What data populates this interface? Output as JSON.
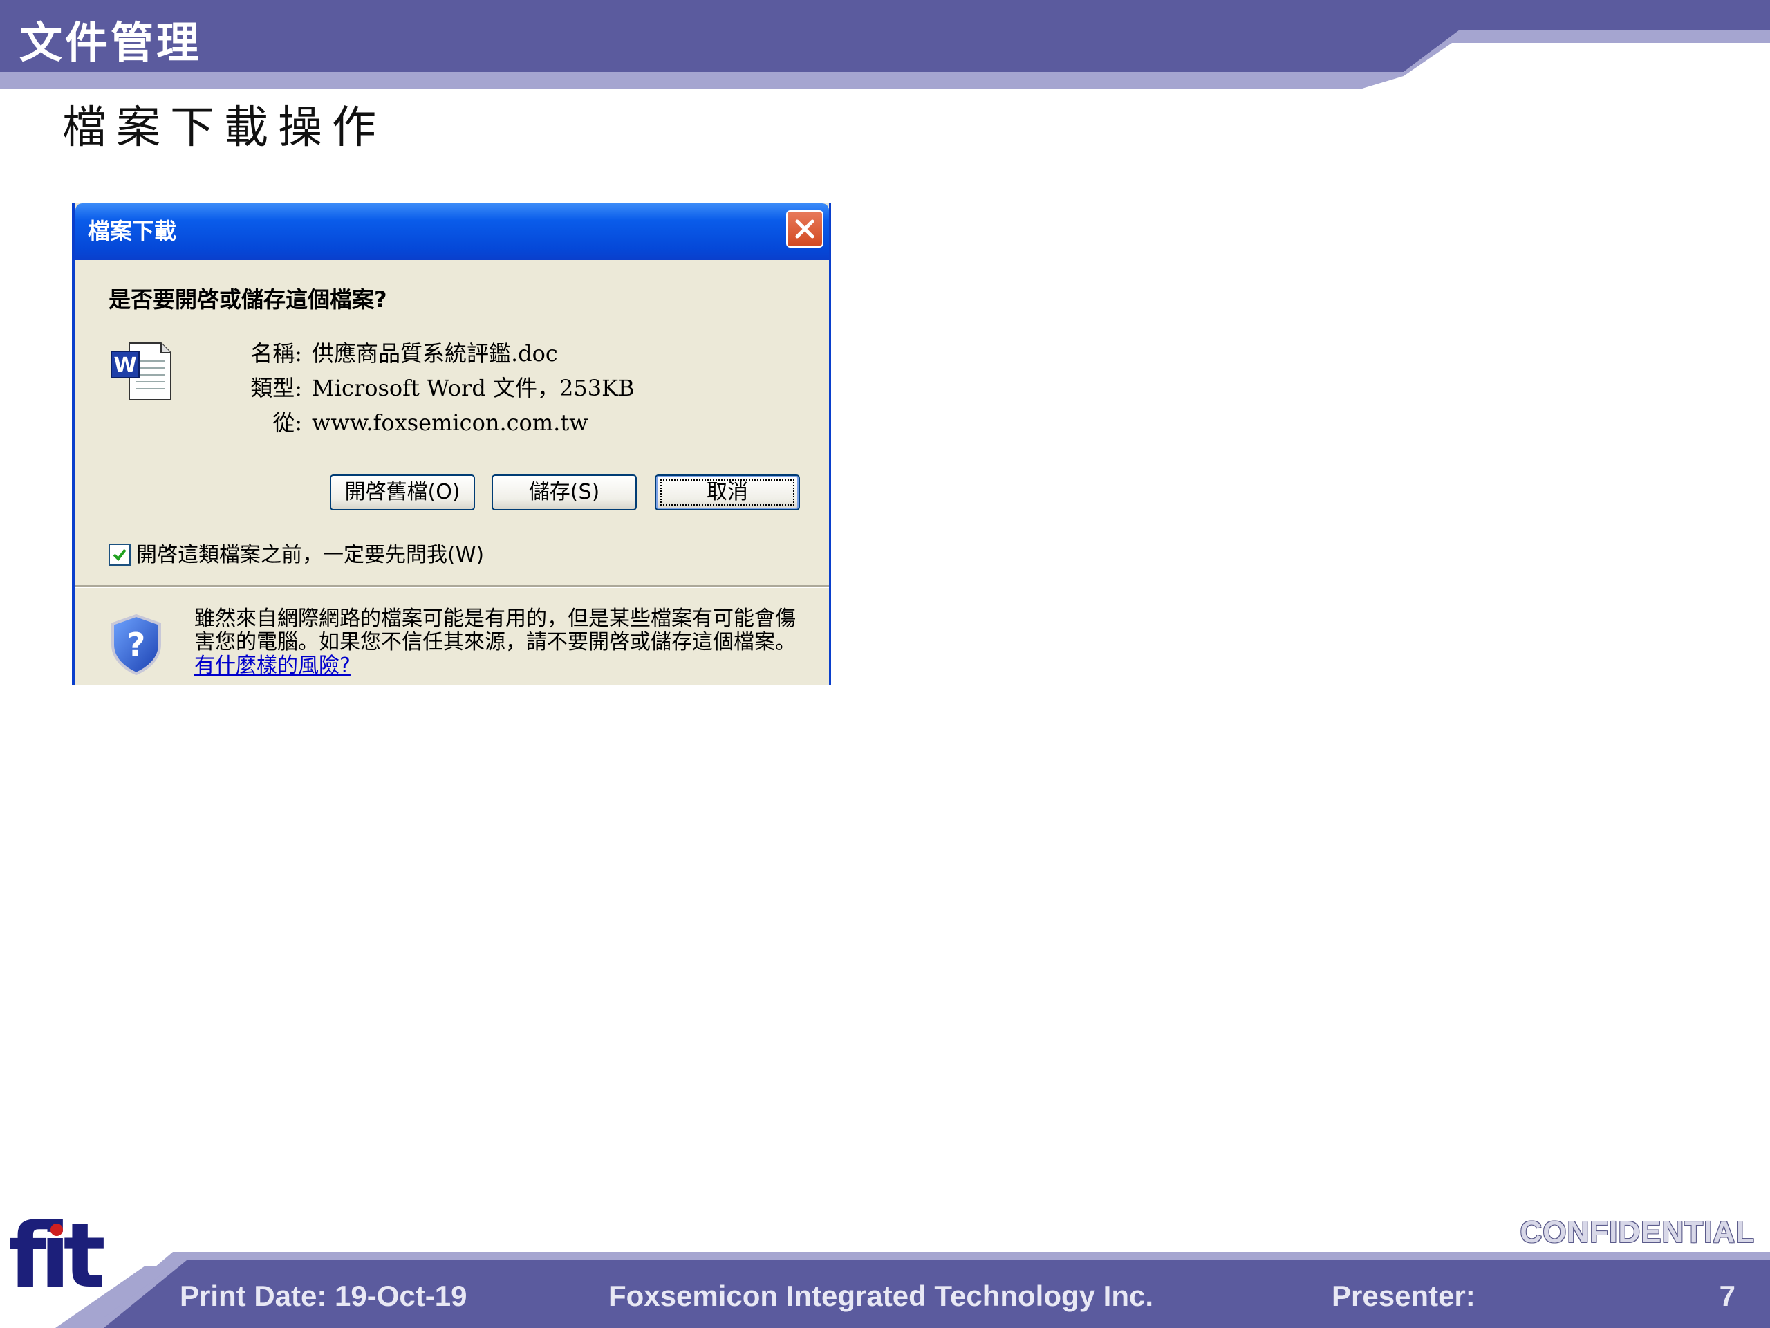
{
  "slide": {
    "title": "文件管理",
    "subtitle": "檔案下載操作"
  },
  "dialog": {
    "title": "檔案下載",
    "question": "是否要開啓或儲存這個檔案?",
    "file": {
      "name_label": "名稱:",
      "name_value": "供應商品質系統評鑑.doc",
      "type_label": "類型:",
      "type_value": "Microsoft Word 文件，253KB",
      "from_label": "從:",
      "from_value": "www.foxsemicon.com.tw"
    },
    "buttons": {
      "open": "開啓舊檔(O)",
      "save": "儲存(S)",
      "cancel": "取消"
    },
    "checkbox_label": "開啓這類檔案之前，一定要先問我(W)",
    "checkbox_checked": true,
    "warning_text": "雖然來自網際網路的檔案可能是有用的，但是某些檔案有可能會傷害您的電腦。如果您不信任其來源，請不要開啓或儲存這個檔案。",
    "warning_link": "有什麼樣的風險?"
  },
  "footer": {
    "logo_text": "fiti",
    "confidential": "CONFIDENTIAL",
    "print_date": "Print Date: 19-Oct-19",
    "company": "Foxsemicon Integrated Technology Inc.",
    "presenter": "Presenter:",
    "page_number": "7"
  },
  "colors": {
    "band_dark": "#5b5b9e",
    "band_light": "#a5a5d0",
    "xp_title_blue": "#0a5cea",
    "dialog_bg": "#ece9d8"
  }
}
